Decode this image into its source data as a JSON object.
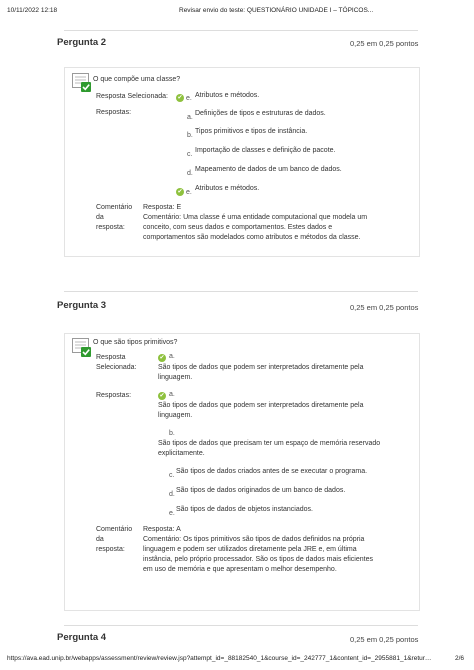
{
  "page_header": {
    "datetime": "10/11/2022 12:18",
    "title": "Revisar envio do teste: QUESTIONÁRIO UNIDADE I – TÓPICOS..."
  },
  "page_footer": {
    "url": "https://ava.ead.unip.br/webapps/assessment/review/review.jsp?attempt_id=_88182540_1&course_id=_242777_1&content_id=_2955881_1&retur…",
    "page": "2/6"
  },
  "labels": {
    "selected": "Resposta Selecionada:",
    "selected_l1": "Resposta",
    "selected_l2": "Selecionada:",
    "answers": "Respostas:",
    "comment_l1": "Comentário",
    "comment_l2": "da",
    "comment_l3": "resposta:"
  },
  "q2": {
    "title": "Pergunta 2",
    "points": "0,25 em 0,25 pontos",
    "question": "O que compõe uma classe?",
    "selected_letter": "e.",
    "selected_text": "Atributos e métodos.",
    "options": [
      {
        "letter": "a.",
        "text": "Definições de tipos e estruturas de dados."
      },
      {
        "letter": "b.",
        "text": "Tipos primitivos e tipos de instância."
      },
      {
        "letter": "c.",
        "text": "Importação de classes e definição de pacote."
      },
      {
        "letter": "d.",
        "text": "Mapeamento de dados de um banco de dados."
      },
      {
        "letter": "e.",
        "text": "Atributos e métodos."
      }
    ],
    "feedback_answer": "Resposta: E",
    "feedback_lines": [
      "Comentário: Uma classe é uma entidade computacional que modela um",
      "conceito, com seus dados e comportamentos. Estes dados e",
      "comportamentos são modelados como atributos e métodos da classe."
    ]
  },
  "q3": {
    "title": "Pergunta 3",
    "points": "0,25 em 0,25 pontos",
    "question": "O que são tipos primitivos?",
    "selected_letter": "a.",
    "selected_lines": [
      "São tipos de dados que podem ser interpretados diretamente pela",
      "linguagem."
    ],
    "opt_a_letter": "a.",
    "opt_a_lines": [
      "São tipos de dados que podem ser interpretados diretamente pela",
      "linguagem."
    ],
    "opt_b_letter": "b.",
    "opt_b_lines": [
      "São tipos de dados que precisam ter um espaço de memória reservado",
      "explicitamente."
    ],
    "opt_c": {
      "letter": "c.",
      "text": "São tipos de dados criados antes de se executar o programa."
    },
    "opt_d": {
      "letter": "d.",
      "text": "São tipos de dados originados de um banco de dados."
    },
    "opt_e": {
      "letter": "e.",
      "text": "São tipos de dados de objetos instanciados."
    },
    "feedback_answer": "Resposta: A",
    "feedback_lines": [
      "Comentário: Os tipos primitivos são tipos de dados definidos na própria",
      "linguagem e podem ser utilizados diretamente pela JRE e, em última",
      "instância, pelo próprio processador. São os tipos de dados mais eficientes",
      "em uso de memória e que apresentam o melhor desempenho."
    ]
  },
  "q4": {
    "title": "Pergunta 4",
    "points": "0,25 em 0,25 pontos"
  },
  "colors": {
    "correct_green": "#8ec13e"
  }
}
